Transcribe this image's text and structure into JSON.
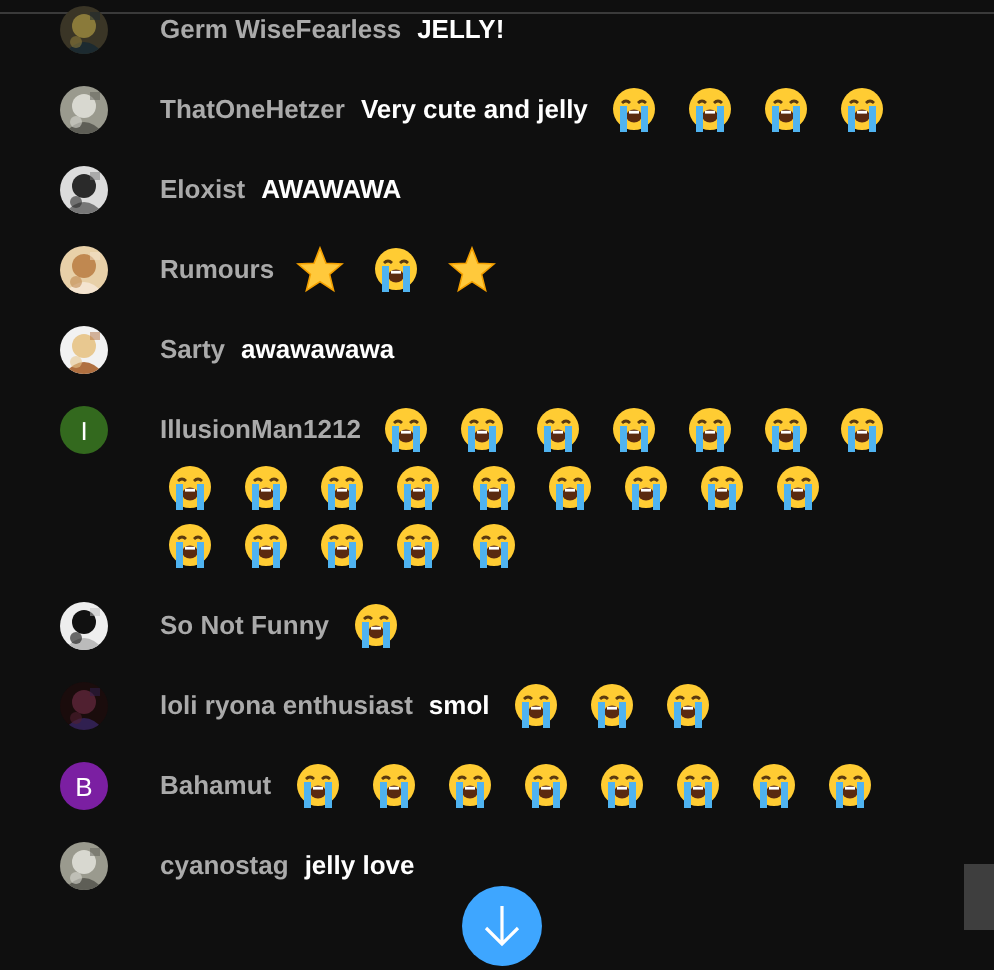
{
  "messages": [
    {
      "author": "Germ WiseFearless",
      "avatar": {
        "kind": "picture"
      },
      "parts": [
        {
          "kind": "text",
          "text": "JELLY!"
        }
      ]
    },
    {
      "author": "ThatOneHetzer",
      "avatar": {
        "kind": "picture"
      },
      "parts": [
        {
          "kind": "text",
          "text": "Very cute and jelly"
        },
        {
          "kind": "sob"
        },
        {
          "kind": "sob"
        },
        {
          "kind": "sob"
        },
        {
          "kind": "sob"
        }
      ]
    },
    {
      "author": "Eloxist",
      "avatar": {
        "kind": "picture"
      },
      "parts": [
        {
          "kind": "text",
          "text": "AWAWAWA"
        }
      ]
    },
    {
      "author": "Rumours",
      "avatar": {
        "kind": "picture"
      },
      "parts": [
        {
          "kind": "star"
        },
        {
          "kind": "sob"
        },
        {
          "kind": "star"
        }
      ]
    },
    {
      "author": "Sarty",
      "avatar": {
        "kind": "picture"
      },
      "parts": [
        {
          "kind": "text",
          "text": "awawawawa"
        }
      ]
    },
    {
      "author": "IllusionMan1212",
      "avatar": {
        "kind": "letter",
        "letter": "I",
        "color": "#33691e"
      },
      "parts": [
        {
          "kind": "sob"
        },
        {
          "kind": "sob"
        },
        {
          "kind": "sob"
        },
        {
          "kind": "sob"
        },
        {
          "kind": "sob"
        },
        {
          "kind": "sob"
        },
        {
          "kind": "sob"
        },
        {
          "kind": "sob"
        },
        {
          "kind": "sob"
        },
        {
          "kind": "sob"
        },
        {
          "kind": "sob"
        },
        {
          "kind": "sob"
        },
        {
          "kind": "sob"
        },
        {
          "kind": "sob"
        },
        {
          "kind": "sob"
        },
        {
          "kind": "sob"
        },
        {
          "kind": "sob"
        },
        {
          "kind": "sob"
        },
        {
          "kind": "sob"
        },
        {
          "kind": "sob"
        },
        {
          "kind": "sob"
        }
      ]
    },
    {
      "author": "So Not Funny",
      "avatar": {
        "kind": "picture"
      },
      "parts": [
        {
          "kind": "sob"
        }
      ]
    },
    {
      "author": "loli ryona enthusiast",
      "avatar": {
        "kind": "picture"
      },
      "parts": [
        {
          "kind": "text",
          "text": "smol"
        },
        {
          "kind": "sob"
        },
        {
          "kind": "sob"
        },
        {
          "kind": "sob"
        }
      ]
    },
    {
      "author": "Bahamut",
      "avatar": {
        "kind": "letter",
        "letter": "B",
        "color": "#7b1fa2"
      },
      "parts": [
        {
          "kind": "sob"
        },
        {
          "kind": "sob"
        },
        {
          "kind": "sob"
        },
        {
          "kind": "sob"
        },
        {
          "kind": "sob"
        },
        {
          "kind": "sob"
        },
        {
          "kind": "sob"
        },
        {
          "kind": "sob"
        }
      ]
    },
    {
      "author": "cyanostag",
      "avatar": {
        "kind": "picture"
      },
      "parts": [
        {
          "kind": "text",
          "text": "jelly love"
        }
      ]
    }
  ]
}
